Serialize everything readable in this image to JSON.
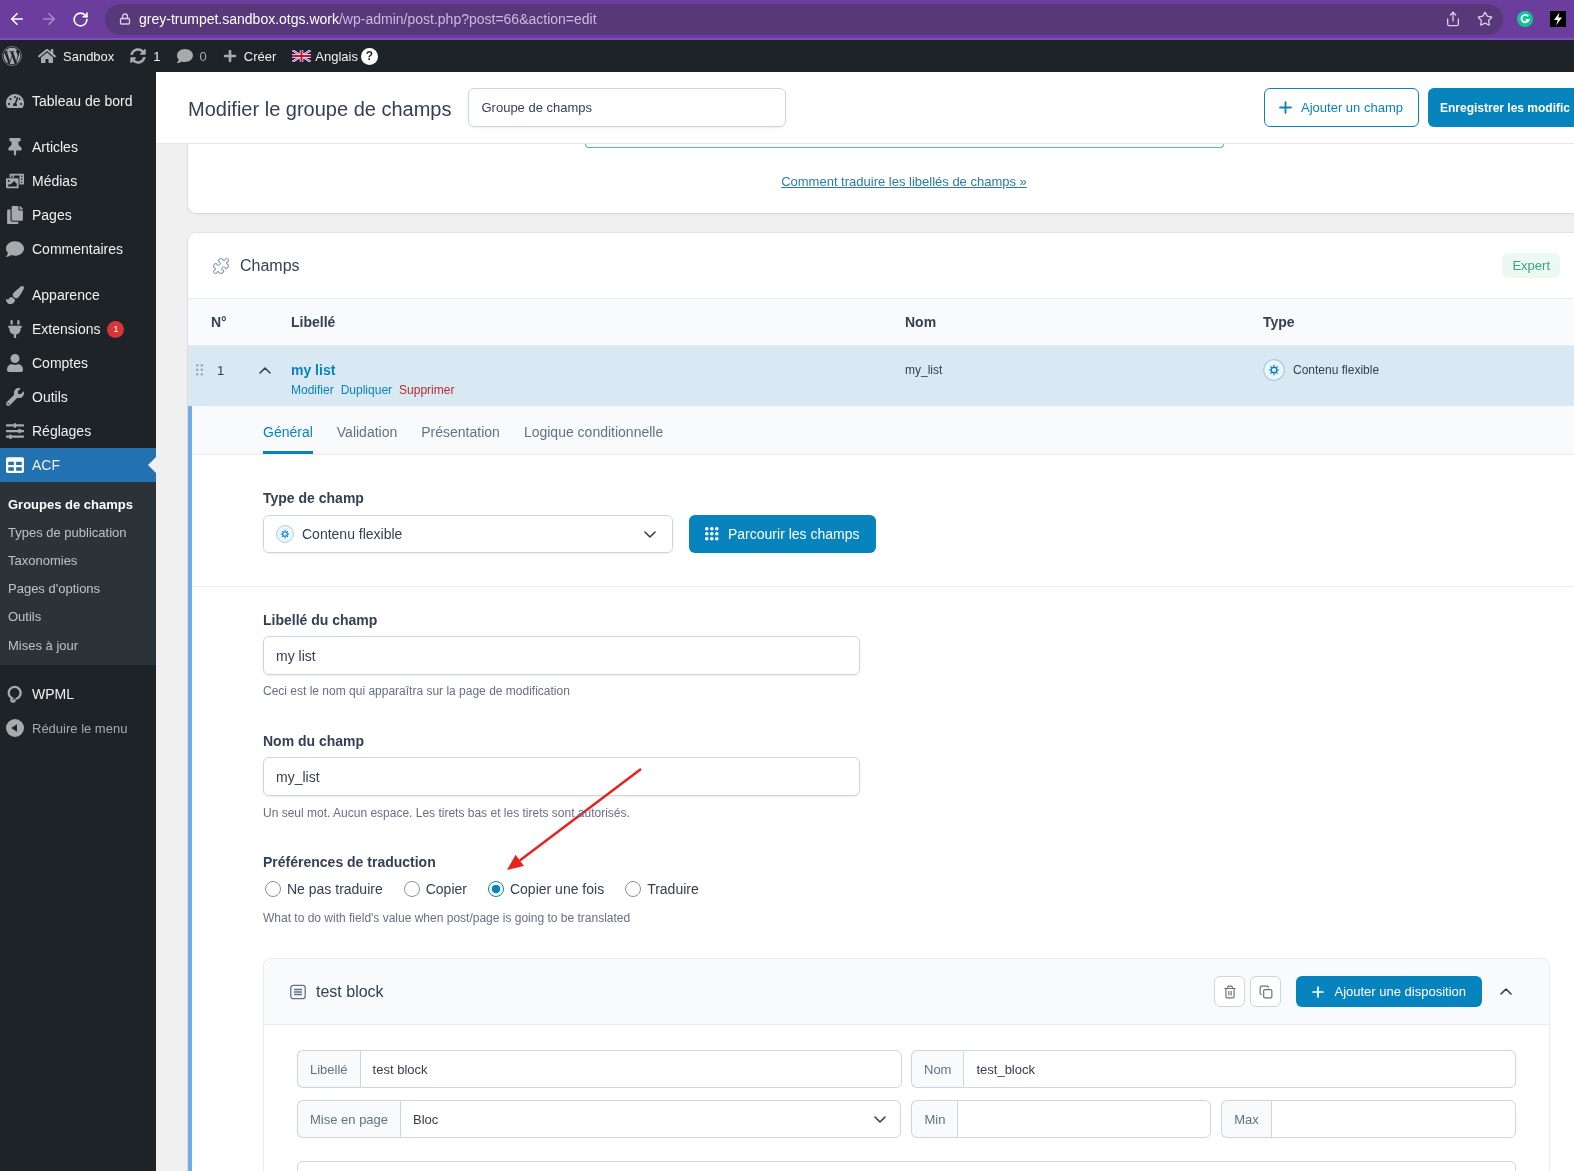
{
  "browser": {
    "forward_disabled": true,
    "url": {
      "host": "grey-trumpet.sandbox.otgs.work",
      "path": "/wp-admin/post.php?post=66&action=edit"
    }
  },
  "admin_bar": {
    "site": "Sandbox",
    "updates": "1",
    "comments": "0",
    "new": "Créer",
    "language": "Anglais",
    "help": "?"
  },
  "sidebar": {
    "groups": [
      {
        "items": [
          {
            "label": "Tableau de bord",
            "selected": false
          }
        ]
      },
      {
        "items": [
          {
            "label": "Articles",
            "selected": false
          },
          {
            "label": "Médias",
            "selected": false
          },
          {
            "label": "Pages",
            "selected": false
          },
          {
            "label": "Commentaires",
            "selected": false
          }
        ]
      },
      {
        "items": [
          {
            "label": "Apparence",
            "selected": false
          },
          {
            "label": "Extensions",
            "selected": false,
            "badge": "1"
          },
          {
            "label": "Comptes",
            "selected": false
          },
          {
            "label": "Outils",
            "selected": false
          },
          {
            "label": "Réglages",
            "selected": false
          },
          {
            "label": "ACF",
            "selected": true,
            "children": [
              {
                "label": "Groupes de champs",
                "selected": true
              },
              {
                "label": "Types de publication",
                "selected": false
              },
              {
                "label": "Taxonomies",
                "selected": false
              },
              {
                "label": "Pages d'options",
                "selected": false
              },
              {
                "label": "Outils",
                "selected": false
              },
              {
                "label": "Mises à jour",
                "selected": false
              }
            ]
          }
        ]
      },
      {
        "items": [
          {
            "label": "WPML",
            "selected": false
          }
        ]
      }
    ],
    "collapse": "Réduire le menu"
  },
  "header": {
    "title": "Modifier le groupe de champs",
    "group_title": "Groupe de champs",
    "buttons": [
      {
        "label": "Ajouter un champ",
        "kind": "secondary"
      },
      {
        "label": "Enregistrer les modific",
        "kind": "primary"
      }
    ]
  },
  "translation_card": {
    "link": "Comment traduire les libellés de champs »"
  },
  "fields_card": {
    "title": "Champs",
    "mode": "Expert",
    "columns": [
      "N°",
      "Libellé",
      "Nom",
      "Type"
    ],
    "rows": [
      {
        "order": "1",
        "label": "my list",
        "name": "my_list",
        "type": "Contenu flexible",
        "expanded": true,
        "actions": [
          {
            "label": "Modifier",
            "kind": "edit"
          },
          {
            "label": "Dupliquer",
            "kind": "duplicate"
          },
          {
            "label": "Supprimer",
            "kind": "delete"
          }
        ]
      }
    ]
  },
  "field_settings": {
    "tabs": [
      {
        "label": "Général",
        "selected": true
      },
      {
        "label": "Validation",
        "selected": false
      },
      {
        "label": "Présentation",
        "selected": false
      },
      {
        "label": "Logique conditionnelle",
        "selected": false
      }
    ],
    "field_type": {
      "label": "Type de champ",
      "value": "Contenu flexible",
      "browse": "Parcourir les champs"
    },
    "inputs": [
      {
        "label": "Libellé du champ",
        "value": "my list",
        "help": "Ceci est le nom qui apparaîtra sur la page de modification"
      },
      {
        "label": "Nom du champ",
        "value": "my_list",
        "help": "Un seul mot. Aucun espace. Les tirets bas et les tirets sont autorisés."
      }
    ],
    "translation": {
      "label": "Préférences de traduction",
      "options": [
        {
          "label": "Ne pas traduire",
          "selected": false
        },
        {
          "label": "Copier",
          "selected": false
        },
        {
          "label": "Copier une fois",
          "selected": true
        },
        {
          "label": "Traduire",
          "selected": false
        }
      ],
      "help": "What to do with field's value when post/page is going to be translated"
    },
    "layouts": [
      {
        "title": "test block",
        "add_button": "Ajouter une disposition",
        "expanded": true,
        "fields": [
          {
            "prefix": "Libellé",
            "value": "test block",
            "kind": "text"
          },
          {
            "prefix": "Nom",
            "value": "test_block",
            "kind": "text"
          },
          {
            "prefix": "Mise en page",
            "value": "Bloc",
            "kind": "select"
          },
          {
            "prefix": "Min",
            "kind": "text"
          },
          {
            "prefix": "Max",
            "kind": "text"
          }
        ]
      }
    ]
  }
}
